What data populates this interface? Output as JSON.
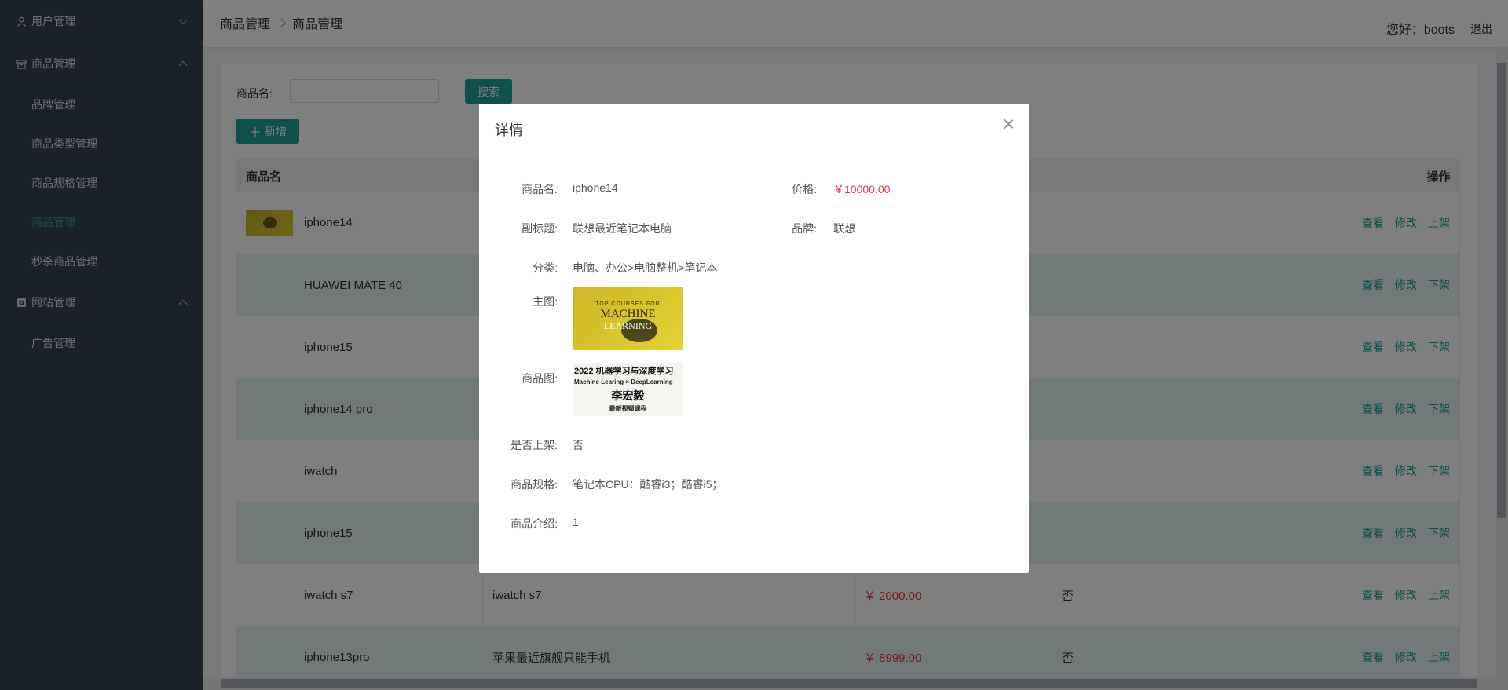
{
  "sidebar": {
    "groups": [
      {
        "label": "用户管理",
        "expanded": false,
        "items": []
      },
      {
        "label": "商品管理",
        "expanded": true,
        "items": [
          {
            "label": "品牌管理",
            "active": false
          },
          {
            "label": "商品类型管理",
            "active": false
          },
          {
            "label": "商品规格管理",
            "active": false
          },
          {
            "label": "商品管理",
            "active": true
          },
          {
            "label": "秒杀商品管理",
            "active": false
          }
        ]
      },
      {
        "label": "网站管理",
        "expanded": true,
        "items": [
          {
            "label": "广告管理",
            "active": false
          }
        ]
      }
    ]
  },
  "header": {
    "breadcrumb": [
      "商品管理",
      "商品管理"
    ],
    "greeting": "您好：boots",
    "logout": "退出"
  },
  "search": {
    "label": "商品名:",
    "value": "",
    "button": "搜索"
  },
  "add_button": "新增",
  "table": {
    "columns": [
      "商品名",
      "操作"
    ],
    "rows": [
      {
        "name": "iphone14",
        "has_thumb": true,
        "subtitle": "",
        "price": "",
        "on_sale": "",
        "actions": [
          "查看",
          "修改",
          "上架"
        ]
      },
      {
        "name": "HUAWEI MATE 40",
        "has_thumb": false,
        "subtitle": "",
        "price": "",
        "on_sale": "",
        "actions": [
          "查看",
          "修改",
          "下架"
        ]
      },
      {
        "name": "iphone15",
        "has_thumb": false,
        "subtitle": "",
        "price": "",
        "on_sale": "",
        "actions": [
          "查看",
          "修改",
          "下架"
        ]
      },
      {
        "name": "iphone14 pro",
        "has_thumb": false,
        "subtitle": "",
        "price": "",
        "on_sale": "",
        "actions": [
          "查看",
          "修改",
          "下架"
        ]
      },
      {
        "name": "iwatch",
        "has_thumb": false,
        "subtitle": "",
        "price": "",
        "on_sale": "",
        "actions": [
          "查看",
          "修改",
          "下架"
        ]
      },
      {
        "name": "iphone15",
        "has_thumb": false,
        "subtitle": "",
        "price": "",
        "on_sale": "",
        "actions": [
          "查看",
          "修改",
          "下架"
        ]
      },
      {
        "name": "iwatch s7",
        "has_thumb": false,
        "subtitle": "iwatch s7",
        "price": "￥ 2000.00",
        "on_sale": "否",
        "actions": [
          "查看",
          "修改",
          "上架"
        ]
      },
      {
        "name": "iphone13pro",
        "has_thumb": false,
        "subtitle": "苹果最近旗舰只能手机",
        "price": "￥ 8999.00",
        "on_sale": "否",
        "actions": [
          "查看",
          "修改",
          "上架"
        ]
      }
    ]
  },
  "modal": {
    "title": "详情",
    "name_label": "商品名:",
    "name": "iphone14",
    "price_label": "价格:",
    "price": "￥10000.00",
    "subtitle_label": "副标题:",
    "subtitle": "联想最近笔记本电脑",
    "brand_label": "品牌:",
    "brand": "联想",
    "category_label": "分类:",
    "category": "电脑、办公>电脑整机>笔记本",
    "main_image_label": "主图:",
    "main_image_text": [
      "TOP COURSES FOR",
      "MACHINE",
      "LEARNING"
    ],
    "product_image_label": "商品图:",
    "product_image_text": [
      "2022 机器学习与深度学习",
      "Machine Learing × DeepLearning",
      "李宏毅",
      "最新视频课程"
    ],
    "on_sale_label": "是否上架:",
    "on_sale": "否",
    "spec_label": "商品规格:",
    "spec": "笔记本CPU：酷睿i3；酷睿i5；",
    "intro_label": "商品介绍:",
    "intro": "1"
  },
  "colors": {
    "sidebar_bg": "#374352",
    "accent": "#1f9e99",
    "price": "#e4393c"
  }
}
